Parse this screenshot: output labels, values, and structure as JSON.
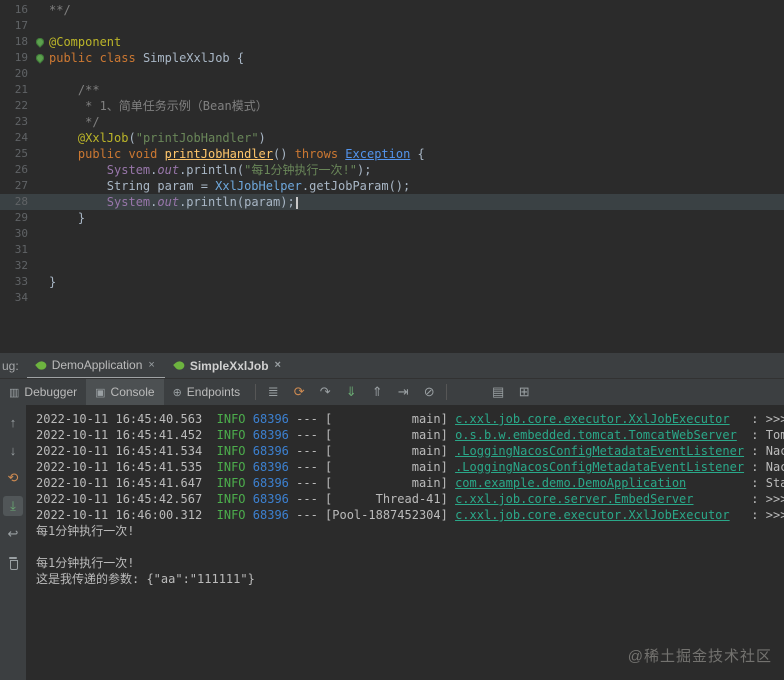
{
  "watermark": "@稀土掘金技术社区",
  "colors": {
    "editor_bg": "#2b2b2b",
    "panel_bg": "#3c3f41",
    "keyword": "#cc7832",
    "string": "#6a8759",
    "annotation": "#bbb529",
    "info_green": "#4cae4c",
    "pid_blue": "#3c80d0",
    "logger_teal": "#2aa889",
    "spring_green": "#6db33f"
  },
  "editor": {
    "lines": [
      {
        "n": 16,
        "segs": [
          [
            "**/",
            "com"
          ]
        ]
      },
      {
        "n": 17,
        "segs": []
      },
      {
        "n": 18,
        "gutter": "spring-bean-icon",
        "segs": [
          [
            "@Component",
            "ann"
          ]
        ]
      },
      {
        "n": 19,
        "gutter": "spring-bean-icon",
        "segs": [
          [
            "public",
            "kw"
          ],
          [
            " ",
            "pl"
          ],
          [
            "class",
            "kw"
          ],
          [
            " SimpleXxlJob {",
            "pl"
          ]
        ]
      },
      {
        "n": 20,
        "segs": []
      },
      {
        "n": 21,
        "segs": [
          [
            "    /**",
            "com"
          ]
        ]
      },
      {
        "n": 22,
        "segs": [
          [
            "     * 1、简单任务示例（Bean模式）",
            "com"
          ]
        ]
      },
      {
        "n": 23,
        "segs": [
          [
            "     */",
            "com"
          ]
        ]
      },
      {
        "n": 24,
        "segs": [
          [
            "    ",
            "pl"
          ],
          [
            "@XxlJob",
            "ann"
          ],
          [
            "(",
            "pl"
          ],
          [
            "\"printJobHandler\"",
            "str"
          ],
          [
            ")",
            "pl"
          ]
        ]
      },
      {
        "n": 25,
        "segs": [
          [
            "    ",
            "pl"
          ],
          [
            "public",
            "kw"
          ],
          [
            " ",
            "pl"
          ],
          [
            "void",
            "kw"
          ],
          [
            " ",
            "pl"
          ],
          [
            "printJobHandler",
            "method"
          ],
          [
            "() ",
            "pl"
          ],
          [
            "throws",
            "kw"
          ],
          [
            " ",
            "pl"
          ],
          [
            "Exception",
            "exc"
          ],
          [
            " {",
            "pl"
          ]
        ]
      },
      {
        "n": 26,
        "segs": [
          [
            "        ",
            "pl"
          ],
          [
            "System",
            "field"
          ],
          [
            ".",
            "pl"
          ],
          [
            "out",
            "fieldit"
          ],
          [
            ".println(",
            "pl"
          ],
          [
            "\"每1分钟执行一次!\"",
            "str"
          ],
          [
            ");",
            "pl"
          ]
        ]
      },
      {
        "n": 27,
        "segs": [
          [
            "        ",
            "pl"
          ],
          [
            "String param = ",
            "pl"
          ],
          [
            "XxlJobHelper",
            "type"
          ],
          [
            ".getJobParam();",
            "pl"
          ]
        ]
      },
      {
        "n": 28,
        "hl": true,
        "caret": true,
        "segs": [
          [
            "        ",
            "pl"
          ],
          [
            "System",
            "field"
          ],
          [
            ".",
            "pl"
          ],
          [
            "out",
            "fieldit"
          ],
          [
            ".println(param);",
            "pl"
          ]
        ]
      },
      {
        "n": 29,
        "segs": [
          [
            "    }",
            "pl"
          ]
        ]
      },
      {
        "n": 30,
        "segs": []
      },
      {
        "n": 31,
        "segs": []
      },
      {
        "n": 32,
        "segs": []
      },
      {
        "n": 33,
        "segs": [
          [
            "}",
            "pl"
          ]
        ]
      },
      {
        "n": 34,
        "segs": []
      }
    ]
  },
  "debug_panel": {
    "dock_label": "ug:",
    "run_tabs": [
      {
        "label": "DemoApplication",
        "close": "×",
        "active": true,
        "bold": false
      },
      {
        "label": "SimpleXxlJob",
        "close": "×",
        "active": false,
        "bold": true
      }
    ],
    "view_tabs": [
      {
        "label": "Debugger",
        "icon_name": "debugger-icon",
        "icon_glyph": "▥",
        "active": false
      },
      {
        "label": "Console",
        "icon_name": "console-icon",
        "icon_glyph": "▣",
        "active": true
      },
      {
        "label": "Endpoints",
        "icon_name": "endpoints-icon",
        "icon_glyph": "⊕",
        "active": false
      }
    ],
    "toolbar_icons": [
      {
        "name": "options-menu-icon",
        "glyph": "≣"
      },
      {
        "name": "rerun-program-icon",
        "glyph": "⟳",
        "color": "#cd8a51"
      },
      {
        "name": "step-over-icon",
        "glyph": "↷"
      },
      {
        "name": "step-into-icon",
        "glyph": "⇓",
        "color": "#6aab73"
      },
      {
        "name": "step-out-icon",
        "glyph": "⇑"
      },
      {
        "name": "run-to-cursor-icon",
        "glyph": "⇥"
      },
      {
        "name": "mute-breakpoints-icon",
        "glyph": "⊘"
      }
    ],
    "toolbar_right_icons": [
      {
        "name": "thread-dump-icon",
        "glyph": "▤"
      },
      {
        "name": "layout-settings-icon",
        "glyph": "⊞"
      }
    ],
    "stripe_icons": [
      {
        "name": "scroll-up-icon",
        "glyph": "↑"
      },
      {
        "name": "scroll-down-icon",
        "glyph": "↓"
      },
      {
        "name": "rerun-icon",
        "glyph": "⟲",
        "color": "#cd8a51"
      },
      {
        "name": "scroll-to-end-icon",
        "glyph": "⤓",
        "color": "#6aab73",
        "selected": true
      },
      {
        "name": "soft-wrap-icon",
        "glyph": "↩"
      },
      {
        "name": "clear-console-icon",
        "shape": "trash"
      }
    ],
    "console": {
      "log_lines": [
        [
          [
            "2022-10-11 16:45:40.563  ",
            "ts"
          ],
          [
            "INFO",
            "info"
          ],
          [
            " ",
            "pl"
          ],
          [
            "68396",
            "pid"
          ],
          [
            " --- [",
            "pl"
          ],
          [
            "           main",
            "pl"
          ],
          [
            "] ",
            "pl"
          ],
          [
            "c.xxl.job.core.executor.XxlJobExecutor",
            "log"
          ],
          [
            "   : >>>>>",
            "pl"
          ]
        ],
        [
          [
            "2022-10-11 16:45:41.452  ",
            "ts"
          ],
          [
            "INFO",
            "info"
          ],
          [
            " ",
            "pl"
          ],
          [
            "68396",
            "pid"
          ],
          [
            " --- [",
            "pl"
          ],
          [
            "           main",
            "pl"
          ],
          [
            "] ",
            "pl"
          ],
          [
            "o.s.b.w.embedded.tomcat.TomcatWebServer",
            "log"
          ],
          [
            "  : Tomca",
            "pl"
          ]
        ],
        [
          [
            "2022-10-11 16:45:41.534  ",
            "ts"
          ],
          [
            "INFO",
            "info"
          ],
          [
            " ",
            "pl"
          ],
          [
            "68396",
            "pid"
          ],
          [
            " --- [",
            "pl"
          ],
          [
            "           main",
            "pl"
          ],
          [
            "] ",
            "pl"
          ],
          [
            ".LoggingNacosConfigMetadataEventListener",
            "log"
          ],
          [
            " : Nacos",
            "pl"
          ]
        ],
        [
          [
            "2022-10-11 16:45:41.535  ",
            "ts"
          ],
          [
            "INFO",
            "info"
          ],
          [
            " ",
            "pl"
          ],
          [
            "68396",
            "pid"
          ],
          [
            " --- [",
            "pl"
          ],
          [
            "           main",
            "pl"
          ],
          [
            "] ",
            "pl"
          ],
          [
            ".LoggingNacosConfigMetadataEventListener",
            "log"
          ],
          [
            " : Nacos",
            "pl"
          ]
        ],
        [
          [
            "2022-10-11 16:45:41.647  ",
            "ts"
          ],
          [
            "INFO",
            "info"
          ],
          [
            " ",
            "pl"
          ],
          [
            "68396",
            "pid"
          ],
          [
            " --- [",
            "pl"
          ],
          [
            "           main",
            "pl"
          ],
          [
            "] ",
            "pl"
          ],
          [
            "com.example.demo.DemoApplication",
            "log"
          ],
          [
            "         : Start",
            "pl"
          ]
        ],
        [
          [
            "2022-10-11 16:45:42.567  ",
            "ts"
          ],
          [
            "INFO",
            "info"
          ],
          [
            " ",
            "pl"
          ],
          [
            "68396",
            "pid"
          ],
          [
            " --- [",
            "pl"
          ],
          [
            "      Thread-41",
            "pl"
          ],
          [
            "] ",
            "pl"
          ],
          [
            "c.xxl.job.core.server.EmbedServer",
            "log"
          ],
          [
            "        : >>>>>",
            "pl"
          ]
        ],
        [
          [
            "2022-10-11 16:46:00.312  ",
            "ts"
          ],
          [
            "INFO",
            "info"
          ],
          [
            " ",
            "pl"
          ],
          [
            "68396",
            "pid"
          ],
          [
            " --- [",
            "pl"
          ],
          [
            "Pool-1887452304",
            "pl"
          ],
          [
            "] ",
            "pl"
          ],
          [
            "c.xxl.job.core.executor.XxlJobExecutor",
            "log"
          ],
          [
            "   : >>>>>",
            "pl"
          ]
        ]
      ],
      "stdout_lines": [
        "每1分钟执行一次!",
        "",
        "每1分钟执行一次!",
        "这是我传递的参数: {\"aa\":\"111111\"}"
      ]
    }
  }
}
